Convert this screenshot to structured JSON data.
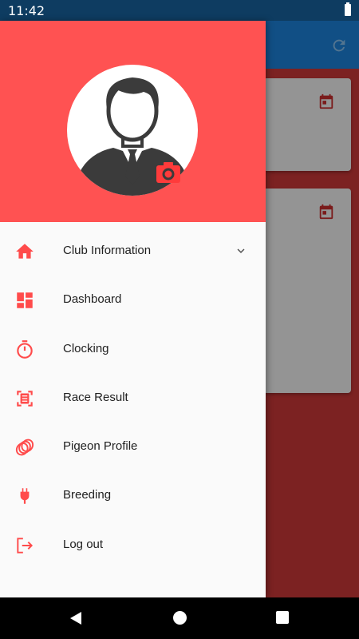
{
  "status": {
    "time": "11:42",
    "battery_icon": "battery-full-icon"
  },
  "colors": {
    "header": "#ff5252",
    "accent": "#ff4b4b",
    "app_bar": "#1e88e5"
  },
  "app_bar": {
    "refresh_icon": "refresh-icon"
  },
  "drawer": {
    "avatar_icon": "user-avatar-icon",
    "camera_icon": "camera-icon",
    "items": [
      {
        "label": "Club Information",
        "icon": "home-icon",
        "expandable": true
      },
      {
        "label": "Dashboard",
        "icon": "dashboard-icon"
      },
      {
        "label": "Clocking",
        "icon": "timer-icon"
      },
      {
        "label": "Race Result",
        "icon": "race-result-icon"
      },
      {
        "label": "Pigeon Profile",
        "icon": "pigeon-rings-icon"
      },
      {
        "label": "Breeding",
        "icon": "plug-icon"
      },
      {
        "label": "Log out",
        "icon": "logout-icon"
      }
    ]
  },
  "nav": {
    "back_icon": "back-icon",
    "home_icon": "home-button-icon",
    "recents_icon": "recents-icon"
  }
}
